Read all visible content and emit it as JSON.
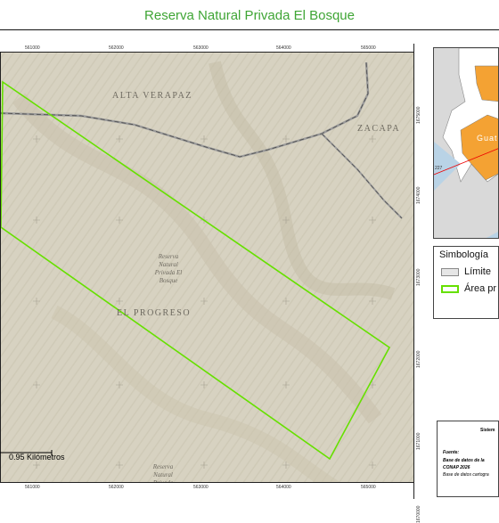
{
  "title": "Reserva Natural Privada El Bosque",
  "map": {
    "regions": {
      "alta_verapaz": "ALTA VERAPAZ",
      "zacapa": "ZACAPA",
      "el_progreso": "EL PROGRESO"
    },
    "reserve_label_lines": [
      "Reserva",
      "Natural",
      "Privada El",
      "Bosque"
    ],
    "reserve_label_bottom_lines": [
      "Reserva",
      "Natural",
      "Privada"
    ],
    "x_ticks_top": [
      "561000",
      "562000",
      "563000",
      "564000",
      "565000"
    ],
    "x_ticks_bottom": [
      "561000",
      "562000",
      "563000",
      "564000",
      "565000"
    ],
    "y_ticks": [
      "1675000",
      "1674000",
      "1673000",
      "1672000",
      "1671000",
      "1670000"
    ],
    "scale_text": "0.95 Kilómetros",
    "colors": {
      "terrain": "#d7d2c1",
      "protected_area": "#66e000",
      "boundary": "#8a8a8a"
    }
  },
  "inset": {
    "label": "Guate",
    "number": "227"
  },
  "legend": {
    "title": "Simbología",
    "items": [
      {
        "label": "Límite",
        "swatch_color": "#e6e6e6",
        "border_color": "#888888"
      },
      {
        "label": "Área pr",
        "swatch_color": "#ffffff",
        "border_color": "#66e000"
      }
    ]
  },
  "info": {
    "title": "Sistem",
    "source_label": "Fuente:",
    "lines": [
      "Base de datos de la",
      "CONAP 2026",
      "Base de datos cartogra"
    ]
  }
}
